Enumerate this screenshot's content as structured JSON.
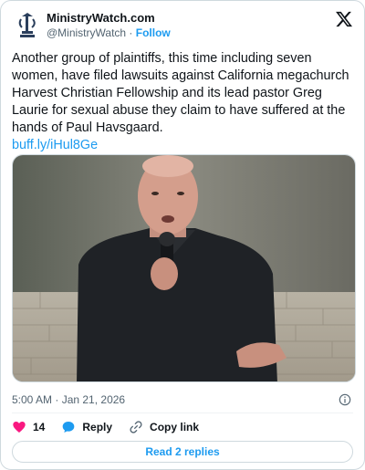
{
  "account": {
    "display_name": "MinistryWatch.com",
    "handle": "@MinistryWatch",
    "separator": "·",
    "follow_label": "Follow",
    "avatar_icon": "ministrywatch-logo"
  },
  "tweet": {
    "text": "Another group of plaintiffs, this time including seven women, have filed lawsuits against California megachurch Harvest Christian Fellowship and its lead pastor Greg Laurie for sexual abuse they claim to have suffered at the hands of Paul Havsgaard.",
    "link": "buff.ly/iHul8Ge",
    "image_alt": "Pastor speaking into a microphone in front of a brick wall"
  },
  "meta": {
    "timestamp": "5:00 AM · Jan 21, 2026"
  },
  "actions": {
    "like_count": "14",
    "reply_label": "Reply",
    "copy_link_label": "Copy link"
  },
  "footer": {
    "read_replies_label": "Read 2 replies"
  },
  "colors": {
    "accent": "#1d9bf0",
    "like": "#f91880",
    "muted": "#536471",
    "border": "#cfd9de"
  }
}
